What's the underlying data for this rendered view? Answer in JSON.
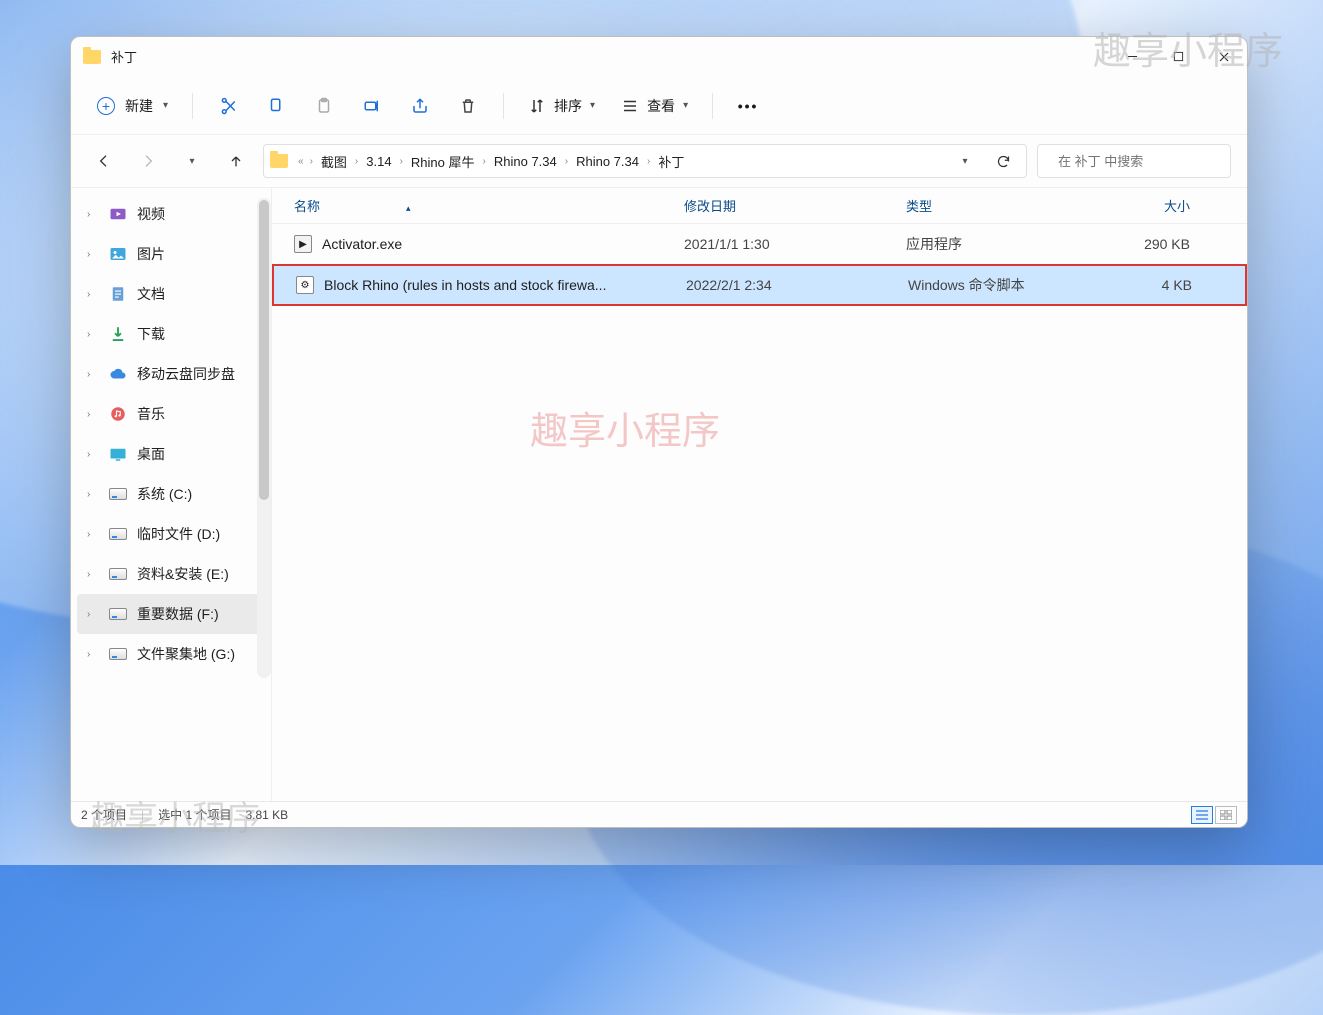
{
  "watermarks": {
    "top": "趣享小程序",
    "mid": "趣享小程序",
    "bot": "趣享小程序"
  },
  "window": {
    "title": "补丁"
  },
  "toolbar": {
    "new": "新建",
    "sort": "排序",
    "view": "查看"
  },
  "breadcrumb": {
    "items": [
      "截图",
      "3.14",
      "Rhino 犀牛",
      "Rhino 7.34",
      "Rhino 7.34",
      "补丁"
    ],
    "ellipsis": "«"
  },
  "search": {
    "placeholder": "在 补丁 中搜索"
  },
  "sidebar": {
    "items": [
      {
        "label": "视频",
        "icon": "video"
      },
      {
        "label": "图片",
        "icon": "pictures"
      },
      {
        "label": "文档",
        "icon": "docs"
      },
      {
        "label": "下载",
        "icon": "download"
      },
      {
        "label": "移动云盘同步盘",
        "icon": "cloud"
      },
      {
        "label": "音乐",
        "icon": "music"
      },
      {
        "label": "桌面",
        "icon": "desktop"
      },
      {
        "label": "系统 (C:)",
        "icon": "drive"
      },
      {
        "label": "临时文件 (D:)",
        "icon": "drive"
      },
      {
        "label": "资料&安装 (E:)",
        "icon": "drive"
      },
      {
        "label": "重要数据 (F:)",
        "icon": "drive",
        "selected": true
      },
      {
        "label": "文件聚集地 (G:)",
        "icon": "drive"
      }
    ]
  },
  "columns": {
    "name": "名称",
    "date": "修改日期",
    "type": "类型",
    "size": "大小"
  },
  "files": [
    {
      "name": "Activator.exe",
      "date": "2021/1/1 1:30",
      "type": "应用程序",
      "size": "290 KB",
      "icon": "exe",
      "selected": false
    },
    {
      "name": "Block Rhino (rules in hosts and stock firewa...",
      "date": "2022/2/1 2:34",
      "type": "Windows 命令脚本",
      "size": "4 KB",
      "icon": "cmd",
      "selected": true
    }
  ],
  "status": {
    "count": "2 个项目",
    "selected": "选中 1 个项目",
    "size": "3.81 KB"
  }
}
